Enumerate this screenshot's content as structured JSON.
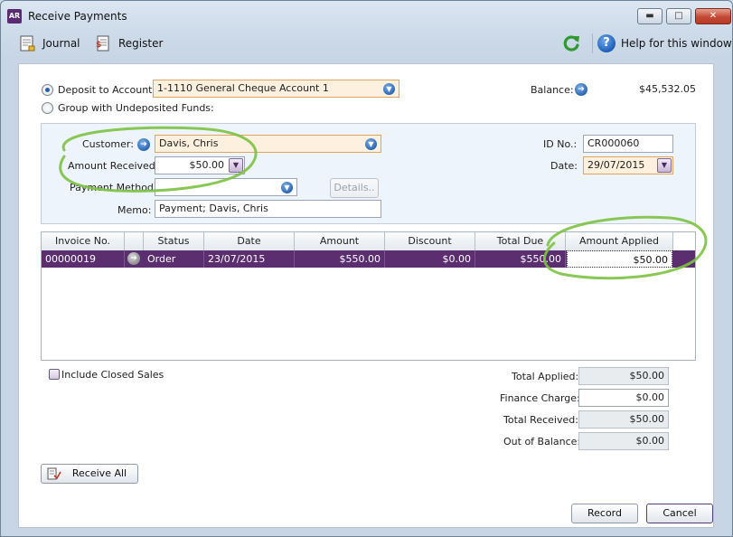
{
  "window": {
    "title": "Receive Payments",
    "icon_text": "AR",
    "min": "▬",
    "max": "□",
    "close": "✕"
  },
  "toolbar": {
    "journal": "Journal",
    "register": "Register",
    "help": "Help for this window",
    "help_glyph": "?"
  },
  "deposit": {
    "deposit_label": "Deposit to Account:",
    "account": "1-1110 General Cheque Account 1",
    "group_label": "Group with Undeposited Funds:",
    "balance_label": "Balance:",
    "balance": "$45,532.05"
  },
  "payment": {
    "customer_label": "Customer:",
    "customer": "Davis, Chris",
    "amount_label": "Amount Received:",
    "amount": "$50.00",
    "method_label": "Payment Method:",
    "method": "",
    "details": "Details..",
    "memo_label": "Memo:",
    "memo": "Payment; Davis, Chris",
    "id_label": "ID No.:",
    "id": "CR000060",
    "date_label": "Date:",
    "date": "29/07/2015"
  },
  "grid": {
    "headers": [
      "Invoice No.",
      "Status",
      "Date",
      "Amount",
      "Discount",
      "Total Due",
      "Amount Applied"
    ],
    "rows": [
      {
        "invoice": "00000019",
        "status": "Order",
        "date": "23/07/2015",
        "amount": "$550.00",
        "discount": "$0.00",
        "total_due": "$550.00",
        "applied": "$50.00"
      }
    ]
  },
  "footer": {
    "include_closed": "Include Closed Sales",
    "total_applied_label": "Total Applied:",
    "total_applied": "$50.00",
    "finance_label": "Finance Charge:",
    "finance": "$0.00",
    "total_received_label": "Total Received:",
    "total_received": "$50.00",
    "out_label": "Out of Balance:",
    "out": "$0.00",
    "receive_all": "Receive All",
    "record": "Record",
    "cancel": "Cancel"
  },
  "colors": {
    "accent": "#5b2e70",
    "highlight_field": "#fdf0de",
    "annotation": "#7cc242"
  }
}
